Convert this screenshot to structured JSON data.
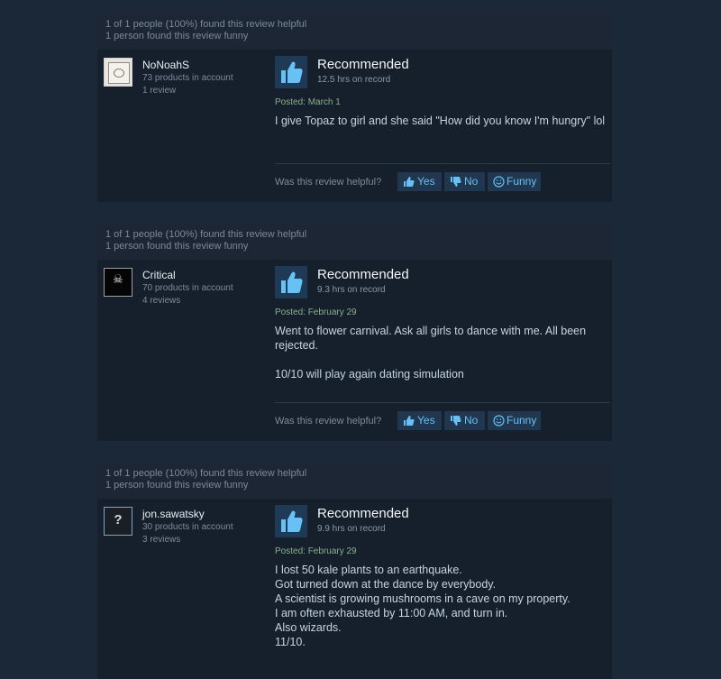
{
  "reviews": [
    {
      "helpful_text": "1 of 1 people (100%) found this review helpful",
      "funny_text": "1 person found this review funny",
      "author": {
        "name": "NoNoahS",
        "products": "73 products in account",
        "reviews": "1 review",
        "avatar": "framed-picture-avatar"
      },
      "verdict": "Recommended",
      "verdict_icon": "thumbs-up-icon",
      "hours": "12.5 hrs on record",
      "posted": "Posted: March 1",
      "text": [
        "I give Topaz to girl and she said \"How did you know I'm hungry\" lol"
      ],
      "helpful_prompt": "Was this review helpful?",
      "buttons": {
        "yes": "Yes",
        "no": "No",
        "funny": "Funny"
      }
    },
    {
      "helpful_text": "1 of 1 people (100%) found this review helpful",
      "funny_text": "1 person found this review funny",
      "author": {
        "name": "Critical",
        "products": "70 products in account",
        "reviews": "4 reviews",
        "avatar": "skull-crossbones-avatar"
      },
      "verdict": "Recommended",
      "verdict_icon": "thumbs-up-icon",
      "hours": "9.3 hrs on record",
      "posted": "Posted: February 29",
      "text": [
        "Went to flower carnival. Ask all girls to dance with me. All been rejected.",
        "10/10 will play again dating simulation"
      ],
      "helpful_prompt": "Was this review helpful?",
      "buttons": {
        "yes": "Yes",
        "no": "No",
        "funny": "Funny"
      }
    },
    {
      "helpful_text": "1 of 1 people (100%) found this review helpful",
      "funny_text": "1 person found this review funny",
      "author": {
        "name": "jon.sawatsky",
        "products": "30 products in account",
        "reviews": "3 reviews",
        "avatar": "question-mark-avatar",
        "avatar_glyph": "?"
      },
      "verdict": "Recommended",
      "verdict_icon": "thumbs-up-icon",
      "hours": "9.9 hrs on record",
      "posted": "Posted: February 29",
      "text_lines": [
        "I lost 50 kale plants to an earthquake.",
        "Got turned down at the dance by everybody.",
        "A scientist is growing mushrooms in a cave on my property.",
        "I am often exhausted by 11:00 AM, and turn in.",
        "Also wizards.",
        "11/10."
      ]
    }
  ],
  "colors": {
    "page_background": "#1b2838",
    "card_background": "#16202d",
    "header_background": "#1c2634",
    "button_background": "#21364f",
    "button_text": "#67c1f5",
    "posted_text": "#8bb08a",
    "body_text": "#c6d4df"
  }
}
